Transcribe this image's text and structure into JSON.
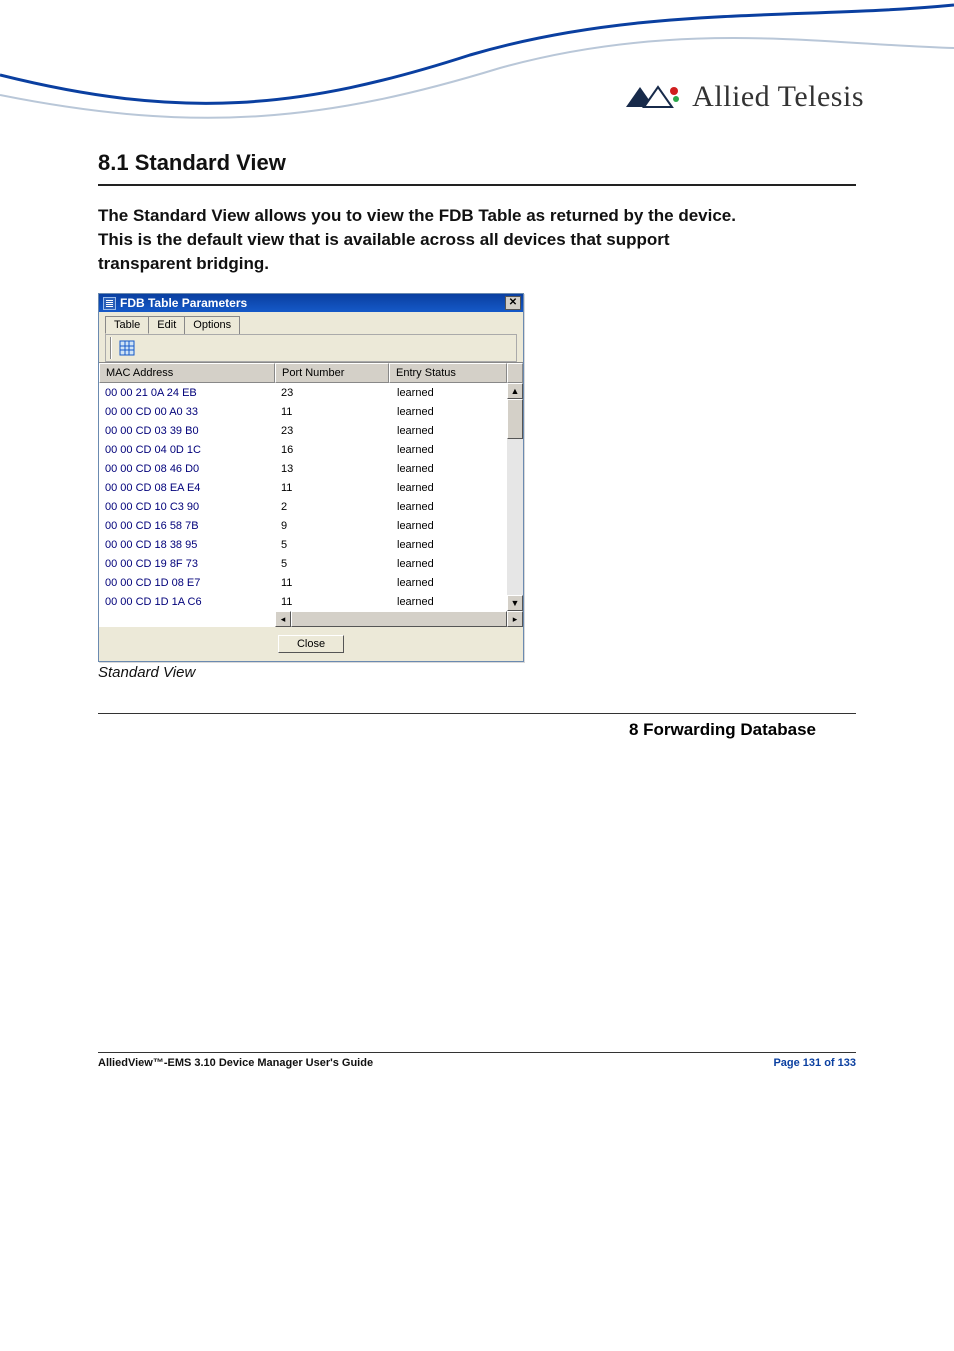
{
  "brand": "Allied Telesis",
  "section_heading": "8.1 Standard View",
  "intro_paragraph": "The Standard View allows you to view the FDB Table as returned by the device. This is the default view that is available across all devices that support transparent bridging.",
  "dialog": {
    "title": "FDB Table Parameters",
    "tabs": [
      "Table",
      "Edit",
      "Options"
    ],
    "columns": [
      "MAC Address",
      "Port Number",
      "Entry Status"
    ],
    "rows": [
      {
        "mac": "00 00 21 0A 24 EB",
        "port": "23",
        "status": "learned"
      },
      {
        "mac": "00 00 CD 00 A0 33",
        "port": "11",
        "status": "learned"
      },
      {
        "mac": "00 00 CD 03 39 B0",
        "port": "23",
        "status": "learned"
      },
      {
        "mac": "00 00 CD 04 0D 1C",
        "port": "16",
        "status": "learned"
      },
      {
        "mac": "00 00 CD 08 46 D0",
        "port": "13",
        "status": "learned"
      },
      {
        "mac": "00 00 CD 08 EA E4",
        "port": "11",
        "status": "learned"
      },
      {
        "mac": "00 00 CD 10 C3 90",
        "port": "2",
        "status": "learned"
      },
      {
        "mac": "00 00 CD 16 58 7B",
        "port": "9",
        "status": "learned"
      },
      {
        "mac": "00 00 CD 18 38 95",
        "port": "5",
        "status": "learned"
      },
      {
        "mac": "00 00 CD 19 8F 73",
        "port": "5",
        "status": "learned"
      },
      {
        "mac": "00 00 CD 1D 08 E7",
        "port": "11",
        "status": "learned"
      },
      {
        "mac": "00 00 CD 1D 1A C6",
        "port": "11",
        "status": "learned"
      }
    ],
    "close_label": "Close"
  },
  "caption": "Standard View",
  "chapter_ref": "8 Forwarding Database",
  "footer_left": "AlliedView™-EMS 3.10 Device Manager User's Guide",
  "footer_right": "Page 131 of 133"
}
